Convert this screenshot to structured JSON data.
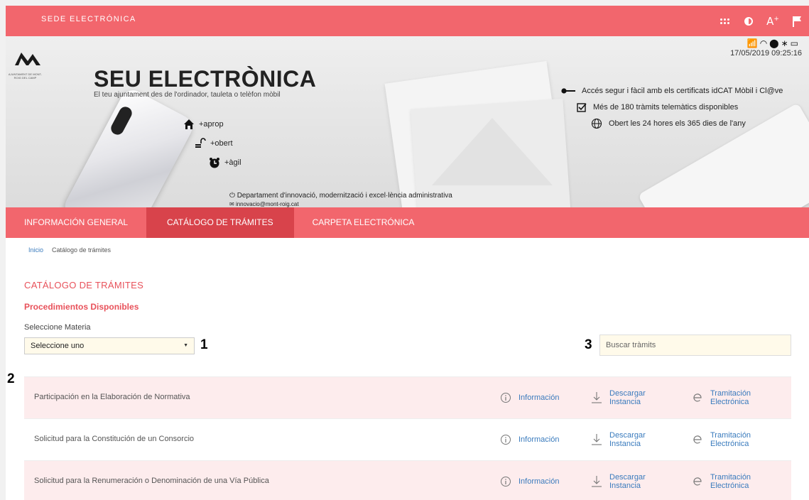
{
  "topbar": {
    "title": "SEDE ELECTRÓNICA",
    "tools": [
      {
        "icon": "grid-dots-icon"
      },
      {
        "icon": "contrast-icon"
      },
      {
        "icon": "font-size-icon",
        "label": "A",
        "sup": "+"
      },
      {
        "icon": "flag-icon"
      }
    ]
  },
  "banner": {
    "status_icons": "📶◠⬤∗▭",
    "datetime": "17/05/2019 09:25:16",
    "logo_text": "AJUNTAMENT DE MONT-ROIG DEL CAMP",
    "title": "SEU ELECTRÒNICA",
    "subtitle": "El teu ajuntament des de l'ordinador, tauleta o telèfon mòbil",
    "pillars": [
      "+aprop",
      "+obert",
      "+àgil"
    ],
    "department": "Departament d'innovació, modernització i excel·lència administrativa",
    "email": "innovacio@mont-roig.cat",
    "features": [
      "Accés segur i fàcil amb els certificats idCAT Mòbil i Cl@ve",
      "Més de 180 tràmits telemàtics disponibles",
      "Obert les 24 hores els 365 dies de l'any"
    ]
  },
  "nav": {
    "items": [
      "INFORMACIÓN GENERAL",
      "CATÁLOGO DE TRÁMITES",
      "CARPETA ELECTRÓNICA"
    ],
    "active": "CATÁLOGO DE TRÁMITES"
  },
  "breadcrumb": {
    "home": "Inicio",
    "current": "Catálogo de trámites"
  },
  "page": {
    "title": "CATÁLOGO DE TRÁMITES",
    "subtitle": "Procedimientos Disponibles",
    "materia_label": "Seleccione Materia",
    "select_value": "Seleccione uno",
    "search_placeholder": "Buscar tràmits"
  },
  "annotations": [
    "1",
    "2",
    "3"
  ],
  "procedures": [
    {
      "name": "Participación en la Elaboración de Normativa",
      "info": "Información",
      "download": "Descargar Instancia",
      "tramit": "Tramitación Electrónica"
    },
    {
      "name": "Solicitud para la Constitución de un Consorcio",
      "info": "Información",
      "download": "Descargar Instancia",
      "tramit": "Tramitación Electrónica"
    },
    {
      "name": "Solicitud para la Renumeración o Denominación de una Vía Pública",
      "info": "Información",
      "download": "Descargar Instancia",
      "tramit": "Tramitación Electrónica"
    }
  ],
  "colors": {
    "brand": "#f2666d",
    "brand_dark": "#d8434b",
    "title": "#e8515a",
    "link": "#3a7bbd",
    "row_alt": "#fdeced",
    "field_bg": "#fffaea"
  }
}
